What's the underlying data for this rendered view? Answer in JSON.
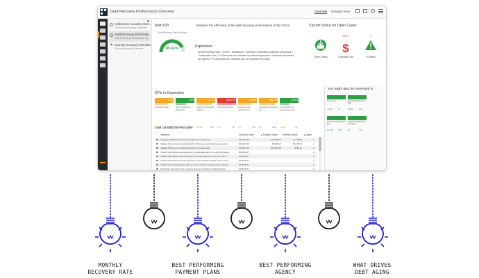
{
  "app": {
    "title": "Debt Recovery Performance Overview",
    "tabs": [
      "Overview",
      "Detailed View"
    ],
    "active_tab": 0
  },
  "list": [
    {
      "title": "Collections Accuracy Over...",
      "subtitle": "Collections Accuracy Overview",
      "icon": "circle-icon"
    },
    {
      "title": "Debt Recovery Performan...",
      "subtitle": "Debt Recovery Performance Ov...",
      "icon": "circle-icon"
    },
    {
      "title": "Scoring Accuracy Overview",
      "subtitle": "Scoring Accuracy Overview",
      "icon": "star-icon"
    }
  ],
  "kpi": {
    "title": "Main KPI",
    "description": "Monitors the efficiency of the debt recovery performance of the SCAs",
    "gauge_caption": "Debt Recovery Rate (Rolling)",
    "gauge_value": "85.61%",
    "gauge_fraction": 0.8561
  },
  "expression": {
    "title": "Expression",
    "text": "ARR(Recovery Rate = (100% - Allocations + Amount in Submitted collection processes + Commission Fee) + % Accounts not collected by external agencies + Amounts recovered per agency + % Accounts not Collected and not Handled for Legal )"
  },
  "current_status": {
    "title": "Current Status for Open Cases",
    "items": [
      {
        "label": "Open Cases",
        "icon": "inbox-download-icon",
        "count": ""
      },
      {
        "label": "Collected Lots",
        "icon": "dollar-icon",
        "count": "1 3 / 1"
      },
      {
        "label": "In Alerts",
        "icon": "alert-bell-icon",
        "count": "1"
      }
    ]
  },
  "kpis_expression": {
    "title": "KPIs in Expression",
    "cards": [
      {
        "value": "1.2%",
        "color": "#f5a623",
        "bar": 0.7,
        "name": "Recovery Rate",
        "a": "13,2%",
        "b": "775"
      },
      {
        "value": "1.4%",
        "color": "#2ea043",
        "bar": 0.55,
        "name": "Sum of Referral Allocation",
        "a": "¥482",
        "b": "€43"
      },
      {
        "value": "22.8%",
        "color": "#f5a623",
        "bar": 0.8,
        "name": "Amount in External Collecti...",
        "a": "22,5%",
        "b": "767"
      },
      {
        "value": "106.17%",
        "color": "#e53935",
        "bar": 1.0,
        "name": "Commission Fee",
        "a": "€17",
        "b": "55"
      },
      {
        "value": "71.88%",
        "color": "#f5a623",
        "bar": 0.72,
        "name": "Accounts not Collected by...",
        "a": "1/7",
        "b": "775"
      },
      {
        "value": "88.1%",
        "color": "#f5a623",
        "bar": 0.85,
        "name": "Amounts recovered per...",
        "a": "8%",
        "b": "44%"
      },
      {
        "value": "26.8%",
        "color": "#2ea043",
        "bar": 0.5,
        "name": "% Accounts not Collected not for...",
        "a": "1,22%",
        "b": "7%"
      }
    ]
  },
  "validations": {
    "title": "Last Validations Results",
    "headers": [
      "Validation",
      "Execution Date",
      "▲ Modified Value",
      "Detected Value",
      "▲ Alerts"
    ],
    "rows": [
      {
        "text": "Customer with Dominant honor running at too much time",
        "date": "2019-07-30",
        "mod": "€ 203,905.1",
        "det": "€ 1 23/03",
        "alert": "1"
      },
      {
        "text": "Validate if the amounts collected by the SCAs are according the payments re...",
        "date": "2019-07-19",
        "mod": "€46,504.6",
        "det": "€11,782.3",
        "alert": "2"
      },
      {
        "text": "Validate if there are commissions paid but not approved",
        "date": "2019-07-18",
        "mod": "€99,951.33",
        "det": "€188.43",
        "alert": "2"
      },
      {
        "text": "Check if the invoices and amounts in the packages are in line with the assess...",
        "date": "2019-06-17",
        "mod": "",
        "det": "",
        "alert": "2"
      },
      {
        "text": "Check if the total amounts collected by external agencies are in line with th...",
        "date": "2019-06-17",
        "mod": "",
        "det": "",
        "alert": "2"
      },
      {
        "text": "Check if the total commissions paid are in line with the average of the previo...",
        "date": "2019-06-17",
        "mod": "",
        "det": "",
        "alert": "2"
      },
      {
        "text": "Check if the total payments made are in line with the average of the previous...",
        "date": "2019-06-17",
        "mod": "",
        "det": "",
        "alert": "2"
      },
      {
        "text": "Identify the agencies in the company given as contacts to distributed and...",
        "date": "2019-06-17",
        "mod": "",
        "det": "",
        "alert": "2"
      }
    ]
  },
  "interested": {
    "title": "You might also be interested in",
    "cards": [
      {
        "name": "Time Gap",
        "a": "1,221",
        "b": "%"
      },
      {
        "name": "Deferral Collections Dist...",
        "a": "€1,3M",
        "b": "11%"
      },
      {
        "name": "Contract Collections By...",
        "a": "£1,221",
        "b": "1%"
      },
      {
        "name": "Contract Collections Accuracy...",
        "a": "€1",
        "b": "1%"
      }
    ]
  },
  "bulbs": [
    {
      "label_line1": "MONTHLY",
      "label_line2": "RECOVERY RATE",
      "lit": true
    },
    {
      "label_line1": "",
      "label_line2": "",
      "lit": false
    },
    {
      "label_line1": "BEST PERFORMING",
      "label_line2": "PAYMENT PLANS",
      "lit": true
    },
    {
      "label_line1": "",
      "label_line2": "",
      "lit": false
    },
    {
      "label_line1": "BEST PERFORMING",
      "label_line2": "AGENCY",
      "lit": true
    },
    {
      "label_line1": "",
      "label_line2": "",
      "lit": false
    },
    {
      "label_line1": "WHAT DRIVES",
      "label_line2": "DEBT AGING",
      "lit": true
    }
  ],
  "colors": {
    "lit_bulb": "#1f1fd6",
    "dark_bulb": "#1a1a1a",
    "accent": "#f39200",
    "green": "#2ea043"
  }
}
